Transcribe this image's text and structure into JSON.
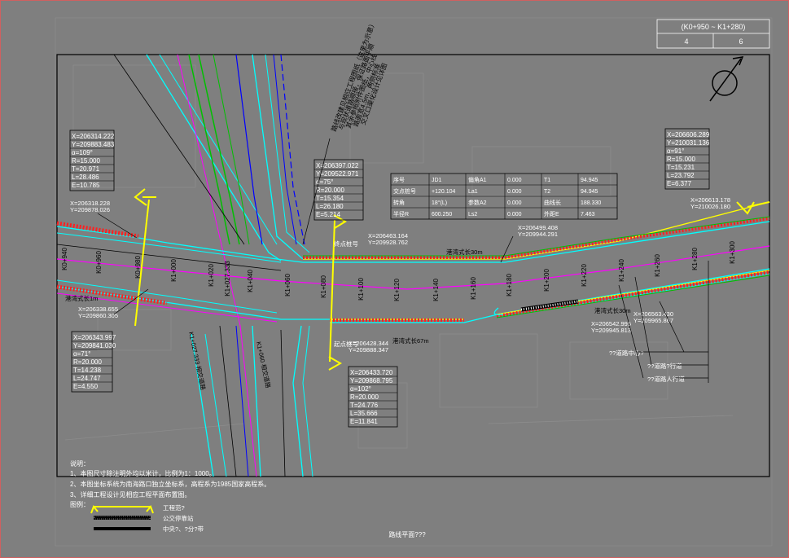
{
  "title_block": {
    "station_range": "(K0+950 ~ K1+280)",
    "sheet_no": "4",
    "sheet_total": "6"
  },
  "drawing_title": "路线平面???",
  "notes": {
    "heading": "说明：",
    "items": [
      "1、本图尺寸除注明外均以米计，比例为1：1000。",
      "2、本图坐标系统为南海路口独立坐标系，高程系为1985国家高程系。",
      "3、详细工程设计见相应工程平面布置图。"
    ]
  },
  "legend": {
    "heading": "图例：",
    "items": [
      {
        "label": "工程范?",
        "icon": "yellow-range-line"
      },
      {
        "label": "公交停靠站",
        "icon": "hatched-bus-bay"
      },
      {
        "label": "中央?、?分?带",
        "icon": "black-median-band"
      }
    ]
  },
  "callouts": {
    "top_left": [
      "X=206314.222",
      "Y=209883.483",
      "α=109°",
      "R=15.000",
      "T=20.971",
      "L=28.486",
      "E=10.785"
    ],
    "top_right": [
      "X=206606.289",
      "Y=210031.136",
      "α=91°",
      "R=15.000",
      "T=15.231",
      "L=23.792",
      "E=6.377"
    ],
    "center_curve": [
      "X=206397.022",
      "Y=209522.971",
      "α=75°",
      "R=20.000",
      "T=15.354",
      "L=26.180",
      "E=5.214"
    ],
    "left_bottom": [
      "X=206343.997",
      "Y=209841.030",
      "α=71°",
      "R=20.000",
      "T=14.238",
      "L=24.747",
      "E=4.550"
    ],
    "bottom_center": [
      "X=206433.720",
      "Y=209868.795",
      "α=102°",
      "R=20.000",
      "T=24.776",
      "L=35.666",
      "E=11.841"
    ]
  },
  "points": {
    "p1": [
      "X=206318.228",
      "Y=209878.026"
    ],
    "p2": [
      "X=206338.655",
      "Y=209860.305"
    ],
    "p3": [
      "X=206463.164",
      "Y=209928.762"
    ],
    "p4": [
      "X=206499.408",
      "Y=209944.291"
    ],
    "p5": [
      "X=206428.344",
      "Y=209888.347"
    ],
    "p6": [
      "X=206542.995",
      "Y=209945.813"
    ],
    "p7": [
      "X=206563.430",
      "Y=209965.867"
    ],
    "p8": [
      "X=206613.178",
      "Y=210026.180"
    ]
  },
  "curve_table": {
    "rows": [
      [
        "序号",
        "JD1",
        "偏角A1",
        "0.000",
        "T1",
        "94.945"
      ],
      [
        "交点桩号",
        "+120.104",
        "La1",
        "0.000",
        "T2",
        "94.945"
      ],
      [
        "转角",
        "18°(L)",
        "参数A2",
        "0.000",
        "曲线长",
        "188.330"
      ],
      [
        "半径R",
        "600.250",
        "Ls2",
        "0.000",
        "外距E",
        "7.463"
      ]
    ]
  },
  "stations": [
    "K0+940",
    "K0+960",
    "K0+980",
    "K1+000",
    "K1+020",
    "K1+027.333",
    "K1+040",
    "K1+060",
    "K1+080",
    "K1+100",
    "K1+120",
    "K1+140",
    "K1+160",
    "K1+180",
    "K1+200",
    "K1+220",
    "K1+240",
    "K1+260",
    "K1+280",
    "K1+300"
  ],
  "labels": {
    "bus_bay_1": "港湾式长30m",
    "bus_bay_2": "港湾式长30m",
    "bus_bay_3": "港湾式长67m",
    "ramp_1": "港湾式长1m",
    "start": "起点桩号",
    "end": "终点桩号",
    "leader_1": "??道路中心?",
    "leader_2": "??道路?行道",
    "leader_3": "??道路人行道",
    "vertical_note": [
      "路线改建见相应工程图纸（这里为示意）",
      "与现状道路顺接，保证路面平顺",
      "其余参照附件图纸，中心线",
      "路面宽4.5m，两侧标准",
      "交叉口渠化设计见详图"
    ],
    "jd_label": "JD1",
    "road_left": "K1+027.333 相交道路",
    "road_right": "K1+060 相交道路"
  },
  "colors": {
    "background": "#7f7f7f",
    "frame": "#000000",
    "alignment": "#ff00ff",
    "edge": "#00ffff",
    "lane": "#0000ff",
    "median": "#00c000",
    "range": "#ffff00",
    "slope": "#ff2020"
  }
}
